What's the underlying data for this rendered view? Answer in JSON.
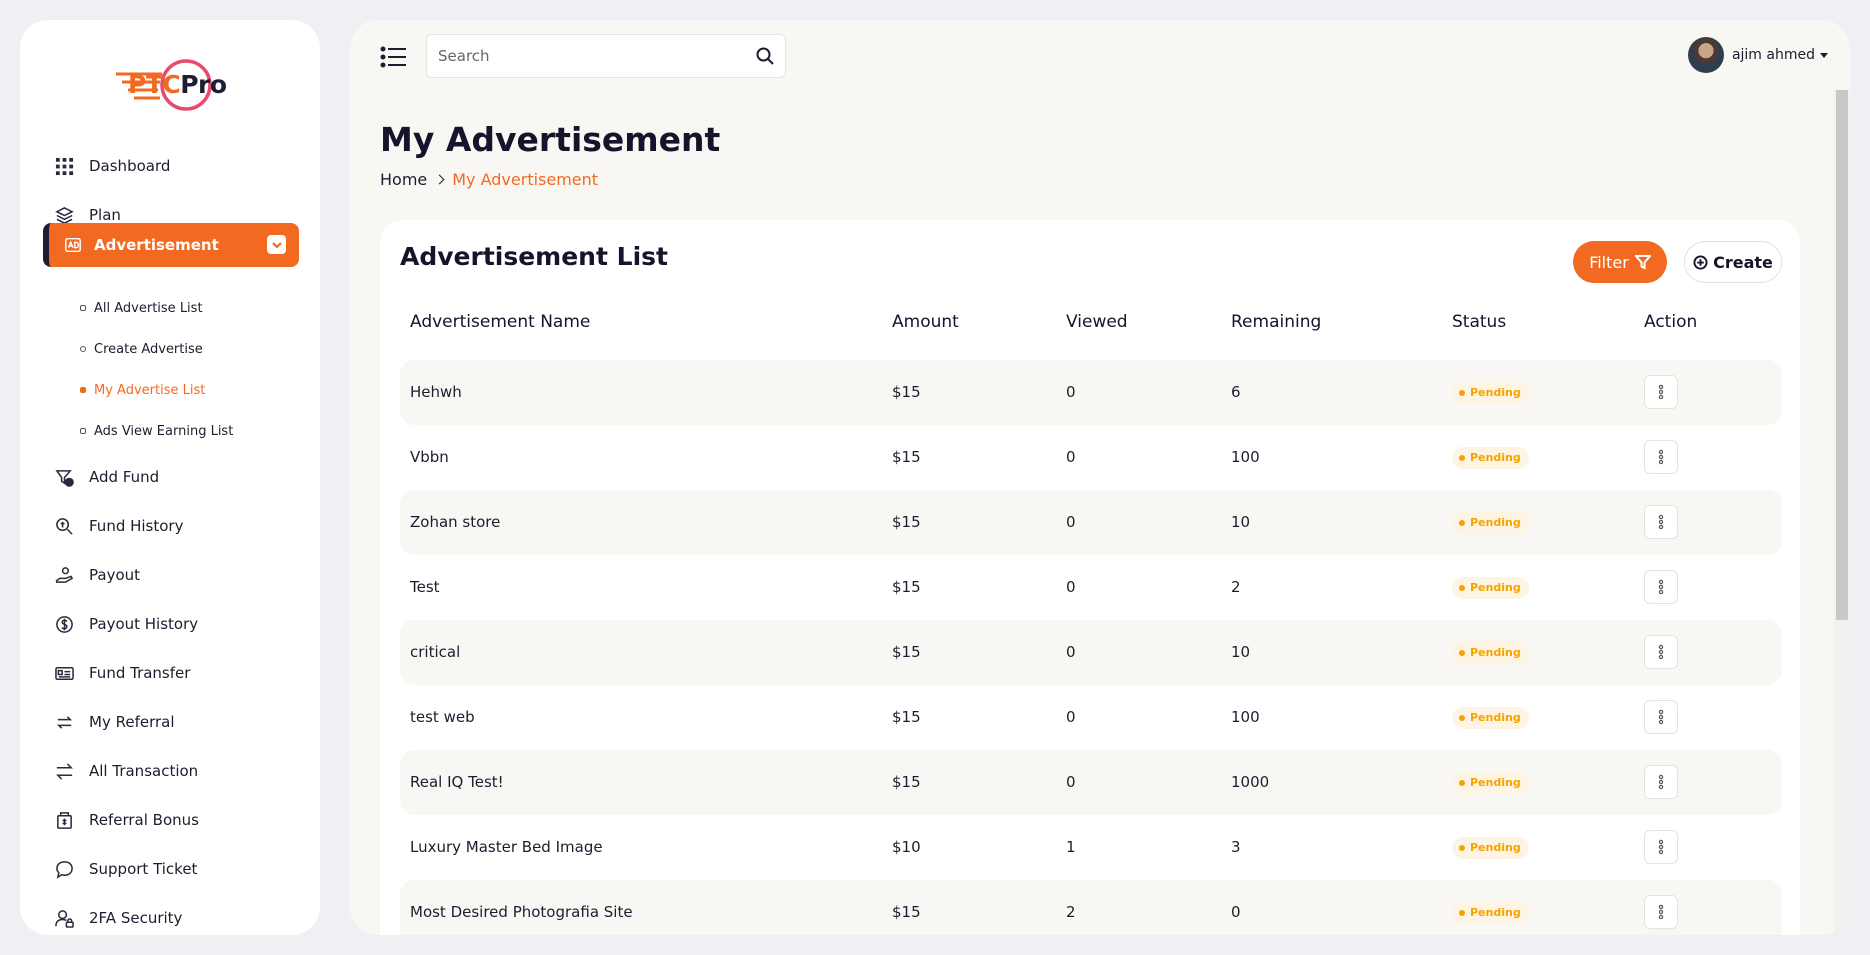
{
  "logo": {
    "ptc": "PTC",
    "pro": "Pro"
  },
  "sidebar": {
    "items": [
      {
        "label": "Dashboard",
        "icon": "grid-icon"
      },
      {
        "label": "Plan",
        "icon": "layers-icon"
      },
      {
        "label": "Advertisement",
        "icon": "ad-icon"
      },
      {
        "label": "Add Fund",
        "icon": "filter-dollar-icon"
      },
      {
        "label": "Fund History",
        "icon": "search-dollar-icon"
      },
      {
        "label": "Payout",
        "icon": "hand-coin-icon"
      },
      {
        "label": "Payout History",
        "icon": "dollar-circle-icon"
      },
      {
        "label": "Fund Transfer",
        "icon": "id-card-icon"
      },
      {
        "label": "My Referral",
        "icon": "repeat-icon"
      },
      {
        "label": "All Transaction",
        "icon": "arrows-swap-icon"
      },
      {
        "label": "Referral Bonus",
        "icon": "gift-dollar-icon"
      },
      {
        "label": "Support Ticket",
        "icon": "chat-icon"
      },
      {
        "label": "2FA Security",
        "icon": "user-lock-icon"
      }
    ],
    "sub_items": [
      {
        "label": "All Advertise List"
      },
      {
        "label": "Create Advertise"
      },
      {
        "label": "My Advertise List"
      },
      {
        "label": "Ads View Earning List"
      }
    ]
  },
  "header": {
    "search_placeholder": "Search",
    "user_name": "ajim ahmed"
  },
  "page": {
    "title": "My Advertisement",
    "breadcrumb_home": "Home",
    "breadcrumb_current": "My Advertisement"
  },
  "card": {
    "title": "Advertisement List",
    "filter_label": "Filter",
    "create_label": "Create"
  },
  "table": {
    "columns": [
      "Advertisement Name",
      "Amount",
      "Viewed",
      "Remaining",
      "Status",
      "Action"
    ],
    "rows": [
      {
        "name": "Hehwh",
        "amount": "$15",
        "viewed": "0",
        "remaining": "6",
        "status": "Pending"
      },
      {
        "name": "Vbbn",
        "amount": "$15",
        "viewed": "0",
        "remaining": "100",
        "status": "Pending"
      },
      {
        "name": "Zohan store",
        "amount": "$15",
        "viewed": "0",
        "remaining": "10",
        "status": "Pending"
      },
      {
        "name": "Test",
        "amount": "$15",
        "viewed": "0",
        "remaining": "2",
        "status": "Pending"
      },
      {
        "name": "critical",
        "amount": "$15",
        "viewed": "0",
        "remaining": "10",
        "status": "Pending"
      },
      {
        "name": "test web",
        "amount": "$15",
        "viewed": "0",
        "remaining": "100",
        "status": "Pending"
      },
      {
        "name": "Real IQ Test!",
        "amount": "$15",
        "viewed": "0",
        "remaining": "1000",
        "status": "Pending"
      },
      {
        "name": "Luxury Master Bed Image",
        "amount": "$10",
        "viewed": "1",
        "remaining": "3",
        "status": "Pending"
      },
      {
        "name": "Most Desired Photografia Site",
        "amount": "$15",
        "viewed": "2",
        "remaining": "0",
        "status": "Pending"
      }
    ]
  },
  "colors": {
    "accent": "#f26a21",
    "dark": "#1d1d2f",
    "pending": "#f5a300"
  }
}
